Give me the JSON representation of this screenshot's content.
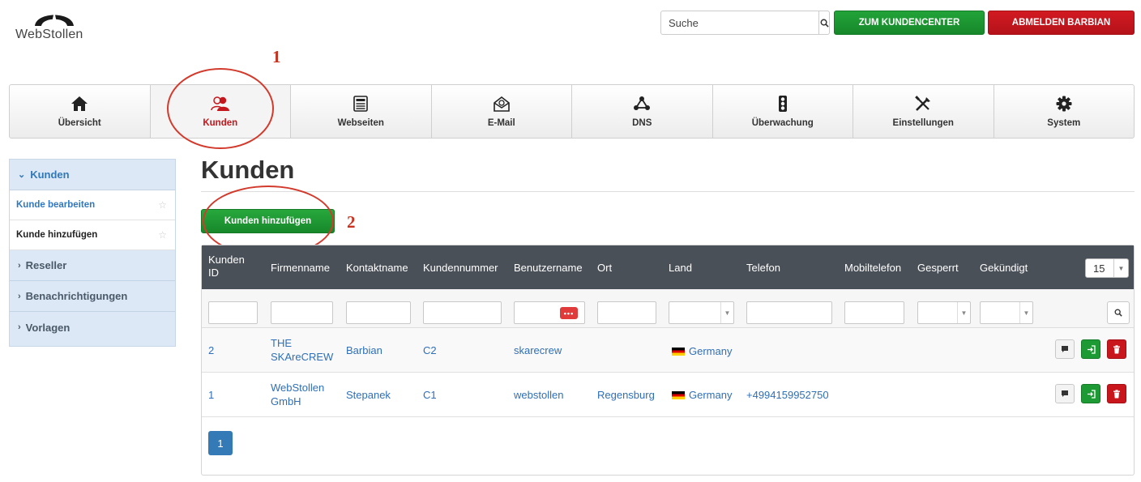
{
  "header": {
    "logo_text": "WebStollen",
    "search_placeholder": "Suche",
    "kundencenter_label": "ZUM KUNDENCENTER",
    "abmelden_label": "ABMELDEN BARBIAN"
  },
  "annotations": {
    "marker_1": "1",
    "marker_2": "2"
  },
  "nav": {
    "items": [
      {
        "label": "Übersicht",
        "icon": "home-icon"
      },
      {
        "label": "Kunden",
        "icon": "users-icon",
        "active": true
      },
      {
        "label": "Webseiten",
        "icon": "webpage-icon"
      },
      {
        "label": "E-Mail",
        "icon": "envelope-icon"
      },
      {
        "label": "DNS",
        "icon": "network-icon"
      },
      {
        "label": "Überwachung",
        "icon": "traffic-light-icon"
      },
      {
        "label": "Einstellungen",
        "icon": "tools-icon"
      },
      {
        "label": "System",
        "icon": "gear-icon"
      }
    ]
  },
  "sidebar": {
    "groups": [
      {
        "label": "Kunden",
        "open": true,
        "items": [
          {
            "label": "Kunde bearbeiten",
            "active": true
          },
          {
            "label": "Kunde hinzufügen"
          }
        ]
      },
      {
        "label": "Reseller"
      },
      {
        "label": "Benachrichtigungen"
      },
      {
        "label": "Vorlagen"
      }
    ]
  },
  "main": {
    "title": "Kunden",
    "add_button_label": "Kunden hinzufügen",
    "table": {
      "columns": [
        "Kunden ID",
        "Firmenname",
        "Kontaktname",
        "Kundennummer",
        "Benutzername",
        "Ort",
        "Land",
        "Telefon",
        "Mobiltelefon",
        "Gesperrt",
        "Gekündigt"
      ],
      "page_size": "15",
      "rows": [
        {
          "id": "2",
          "firma": "THE SKAreCREW",
          "kontakt": "Barbian",
          "kundennummer": "C2",
          "benutzer": "skarecrew",
          "ort": "",
          "land": "Germany",
          "telefon": "",
          "mobil": ""
        },
        {
          "id": "1",
          "firma": "WebStollen GmbH",
          "kontakt": "Stepanek",
          "kundennummer": "C1",
          "benutzer": "webstollen",
          "ort": "Regensburg",
          "land": "Germany",
          "telefon": "+4994159952750",
          "mobil": ""
        }
      ],
      "current_page": "1"
    }
  },
  "colors": {
    "brand_green": "#1e9a34",
    "brand_red": "#c9161d",
    "header_dark": "#4a5057",
    "link_blue": "#2f6fb7",
    "annotation_red": "#d23a2c"
  }
}
